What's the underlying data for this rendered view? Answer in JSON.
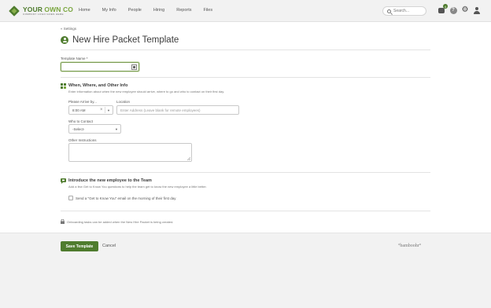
{
  "brand": {
    "name_part1": "YOUR",
    "name_part2": " OWN CO",
    "tagline": "COMPANY LOGO GOES HERE"
  },
  "nav": {
    "items": [
      "Home",
      "My Info",
      "People",
      "Hiring",
      "Reports",
      "Files"
    ]
  },
  "search": {
    "placeholder": "Search..."
  },
  "header_icons": {
    "messages_badge": "4",
    "help_label": "?"
  },
  "breadcrumb": "« Settings",
  "page_title": "New Hire Packet Template",
  "form": {
    "template_name_label": "Template Name *",
    "template_name_value": "",
    "section_when_where": {
      "title": "When, Where, and Other Info",
      "description": "Enter information about when the new employee should arrive, where to go and who to contact on their first day.",
      "arrive_label": "Please Arrive by...",
      "arrive_value": "8:00 AM",
      "location_label": "Location",
      "location_placeholder": "Enter Address (Leave blank for remote employees)",
      "contact_label": "Who to Contact",
      "contact_value": "-Select-",
      "other_label": "Other Instructions"
    },
    "section_introduce": {
      "title": "Introduce the new employee to the Team",
      "description": "Add a few Get to Know You questions to help the team get to know the new employee a little better.",
      "checkbox_label": "Send a \"Get to Know You\" email on the morning of their first day"
    },
    "note": "Onboarding tasks can be added when the New Hire Packet is being created."
  },
  "footer": {
    "save_label": "Save Template",
    "cancel_label": "Cancel",
    "powered_by": "°bamboohr°"
  },
  "colors": {
    "accent": "#4f7c2e",
    "accent_light": "#7aa63f",
    "topbar_bg": "#f2f2f2"
  }
}
